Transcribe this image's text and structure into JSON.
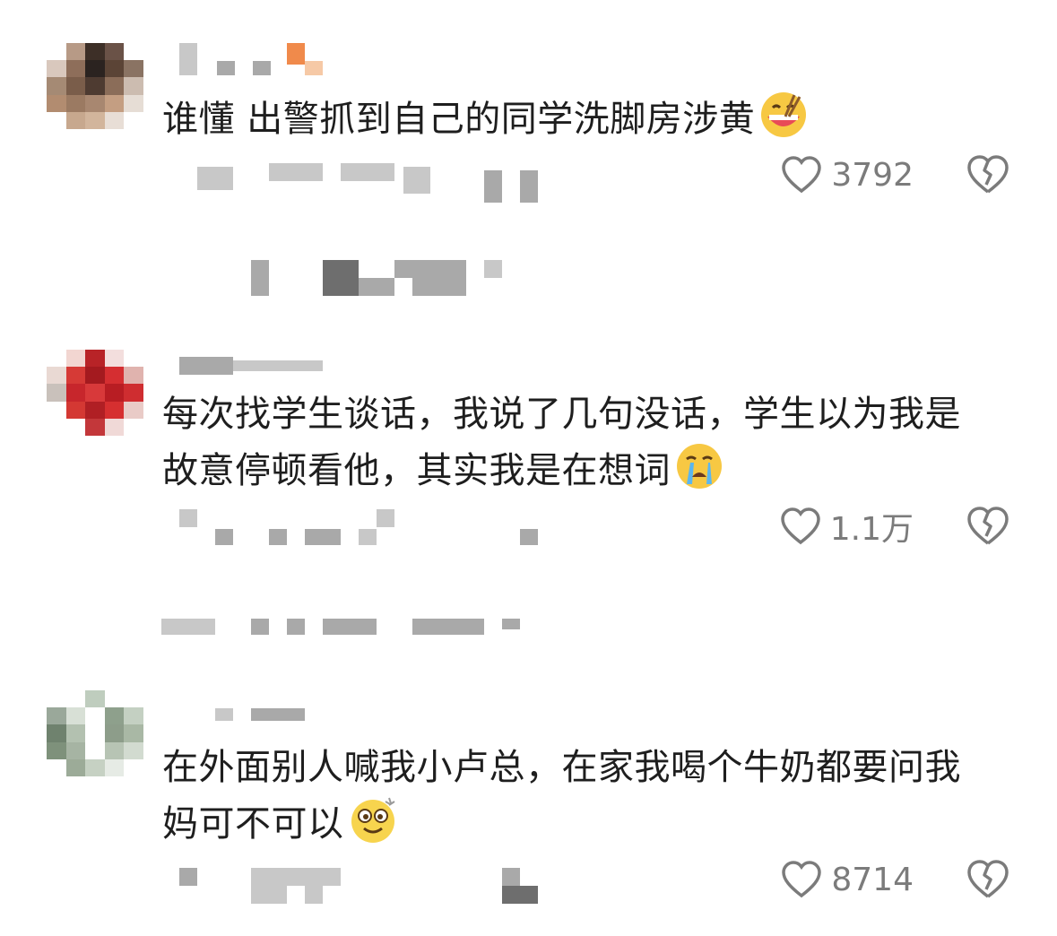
{
  "comments": [
    {
      "text": "谁懂 出警抓到自己的同学洗脚房涉黄",
      "emoji": "laughing-eating-emoji",
      "likes": "3792",
      "avatar_colors": [
        "#ffffff",
        "#b79a86",
        "#3d2f27",
        "#6a5247",
        "#ffffff",
        "#d9c8bd",
        "#8e6e5a",
        "#2b2320",
        "#5b4436",
        "#8a7363",
        "#a58a74",
        "#7a5d4a",
        "#4e3b31",
        "#8b6d59",
        "#ccbcb0",
        "#b28c70",
        "#9b7a62",
        "#a88770",
        "#c49e82",
        "#e6ddd5",
        "#ffffff",
        "#c7a88e",
        "#d2b59c",
        "#e8ded6",
        "#ffffff"
      ]
    },
    {
      "text": "每次找学生谈话，我说了几句没话，学生以为我是故意停顿看他，其实我是在想词",
      "emoji": "crying-emoji",
      "likes": "1.1万",
      "avatar_colors": [
        "#ffffff",
        "#f2d6d1",
        "#b82327",
        "#f3dedd",
        "#ffffff",
        "#e9d9d3",
        "#d63a36",
        "#a41a1f",
        "#d52e31",
        "#e0b3ae",
        "#c9c1bb",
        "#c7262c",
        "#d8393a",
        "#b81d23",
        "#cf2d30",
        "#ffffff",
        "#d43833",
        "#b01f24",
        "#d62f30",
        "#e9cbc7",
        "#ffffff",
        "#ffffff",
        "#c3373a",
        "#f0d9d7",
        "#ffffff"
      ]
    },
    {
      "text": "在外面别人喊我小卢总，在家我喝个牛奶都要问我妈可不可以",
      "emoji": "dizzy-smile-emoji",
      "likes": "8714",
      "avatar_colors": [
        "#ffffff",
        "#ffffff",
        "#bfcdbe",
        "#ffffff",
        "#ffffff",
        "#9aa89a",
        "#d8e0d6",
        "#ffffff",
        "#8ea08c",
        "#c4d0c2",
        "#6f826e",
        "#b3c1b0",
        "#ffffff",
        "#8d9d8a",
        "#a9b8a5",
        "#7e917b",
        "#a6b4a3",
        "#ffffff",
        "#b7c4b4",
        "#d2dbd0",
        "#ffffff",
        "#9cab98",
        "#c6d1c3",
        "#e6ebe5",
        "#ffffff"
      ]
    }
  ],
  "colors": {
    "text": "#1e1e1e",
    "meta": "#7b7b7b"
  }
}
